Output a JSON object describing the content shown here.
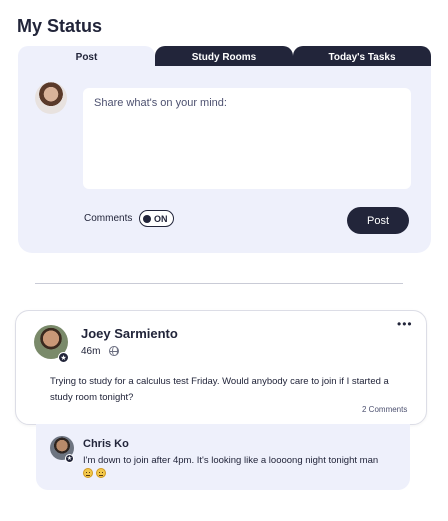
{
  "header": {
    "title": "My Status"
  },
  "tabs": [
    {
      "label": "Post",
      "active": true
    },
    {
      "label": "Study Rooms",
      "active": false
    },
    {
      "label": "Today's Tasks",
      "active": false
    }
  ],
  "composer": {
    "placeholder": "Share what's on your mind:",
    "comments_label": "Comments",
    "comments_toggle": "ON",
    "post_button": "Post"
  },
  "feed": {
    "post": {
      "author": "Joey Sarmiento",
      "time": "46m",
      "body": "Trying to study for a calculus test Friday. Would anybody care to join if I started a study room tonight?",
      "comment_count": "2 Comments",
      "more_icon": "more-horizontal-icon",
      "visibility_icon": "globe-icon"
    },
    "comment": {
      "author": "Chris Ko",
      "text": "I'm down to join after 4pm. It's looking like a loooong night tonight man",
      "emoji_icon": "tired-face-emoji",
      "emoji_count": 2
    }
  },
  "colors": {
    "primary": "#22253a",
    "panel": "#eef0fb",
    "emoji": "#f2c84b"
  }
}
